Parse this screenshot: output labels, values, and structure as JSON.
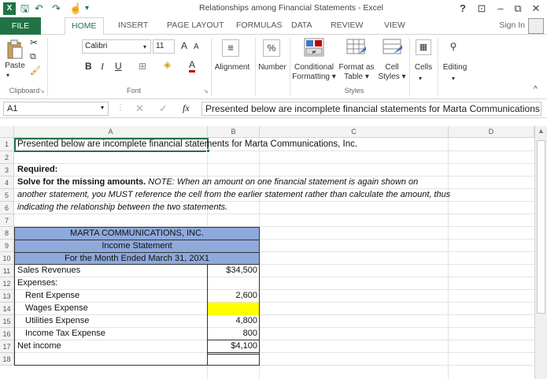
{
  "window": {
    "title": "Relationships among Financial Statements - Excel",
    "help": "?",
    "min": "–",
    "restore": "⧉",
    "close": "✕",
    "ribbon_display": "⊡"
  },
  "qat": {
    "logo": "X",
    "save": "🖫",
    "undo": "↶",
    "redo": "↷",
    "touch": "☝",
    "customize": "▾"
  },
  "tabs": [
    "FILE",
    "HOME",
    "INSERT",
    "PAGE LAYOUT",
    "FORMULAS",
    "DATA",
    "REVIEW",
    "VIEW"
  ],
  "signin": "Sign In",
  "ribbon": {
    "clipboard": {
      "paste": "Paste",
      "label": "Clipboard"
    },
    "font": {
      "name": "Calibri",
      "size": "11",
      "grow": "A",
      "shrink": "A",
      "bold": "B",
      "italic": "I",
      "underline": "U",
      "label": "Font"
    },
    "alignment": {
      "label": "Alignment"
    },
    "number": {
      "symbol": "%",
      "label": "Number"
    },
    "styles": {
      "cond": "Conditional",
      "cond2": "Formatting",
      "format_table": "Format as",
      "format_table2": "Table",
      "cell_styles": "Cell",
      "cell_styles2": "Styles",
      "label": "Styles"
    },
    "cells": {
      "label": "Cells"
    },
    "editing": {
      "label": "Editing"
    }
  },
  "formula_bar": {
    "namebox": "A1",
    "cancel": "✕",
    "enter": "✓",
    "fx": "fx",
    "content": "Presented below are incomplete financial statements for Marta Communications, Inc."
  },
  "columns": [
    "A",
    "B",
    "C",
    "D"
  ],
  "rows": [
    "1",
    "2",
    "3",
    "4",
    "5",
    "6",
    "7",
    "8",
    "9",
    "10",
    "11",
    "12",
    "13",
    "14",
    "15",
    "16",
    "17",
    "18"
  ],
  "cells": {
    "r1": "Presented below are incomplete financial statements for Marta Communications, Inc.",
    "r3": "Required:",
    "r4a": "Solve for the missing amounts.",
    "r4b": "NOTE:  When an amount on one financial statement is again shown on",
    "r5": "another statement, you MUST reference the cell from the earlier statement rather than calculate the amount, thus",
    "r6": "indicating the relationship between the two statements.",
    "r8": "MARTA COMMUNICATIONS, INC.",
    "r9": "Income Statement",
    "r10": "For the Month Ended  March 31, 20X1",
    "r11a": "Sales Revenues",
    "r11b": "$34,500",
    "r12a": "Expenses:",
    "r13a": "Rent Expense",
    "r13b": "2,600",
    "r14a": "Wages Expense",
    "r14b": "",
    "r15a": "Utilities Expense",
    "r15b": "4,800",
    "r16a": "Income Tax Expense",
    "r16b": "800",
    "r17a": "Net income",
    "r17b": "$4,100"
  },
  "colors": {
    "excel_green": "#217346",
    "header_fill": "#8EA9DB",
    "input_fill": "#FFFF00"
  }
}
